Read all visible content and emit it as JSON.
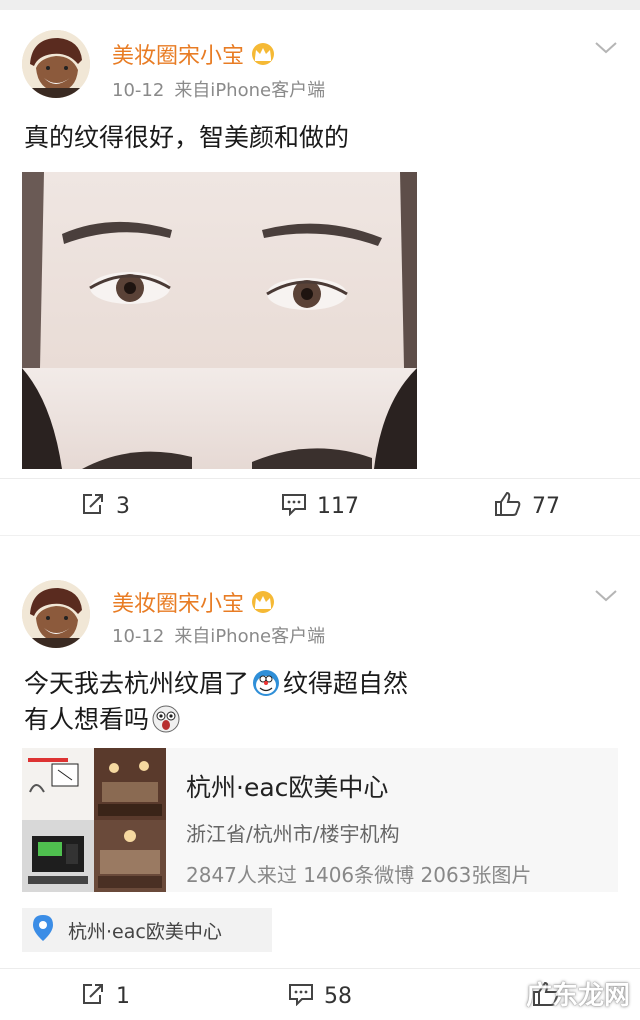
{
  "post1": {
    "username": "美妆圈宋小宝",
    "date": "10-12",
    "source": "来自iPhone客户端",
    "text": "真的纹得很好，智美颜和做的",
    "repost_count": "3",
    "comment_count": "117",
    "like_count": "77"
  },
  "post2": {
    "username": "美妆圈宋小宝",
    "date": "10-12",
    "source": "来自iPhone客户端",
    "text_part1": "今天我去杭州纹眉了",
    "text_part2": "纹得超自然",
    "text_line2": "有人想看吗",
    "card": {
      "title": "杭州·eac欧美中心",
      "subtitle": "浙江省/杭州市/楼宇机构",
      "stats": "2847人来过 1406条微博 2063张图片"
    },
    "location": "杭州·eac欧美中心",
    "repost_count": "1",
    "comment_count": "58"
  },
  "watermark": "广东龙网",
  "colors": {
    "username": "#e87c24",
    "meta": "#8a8a8a",
    "accent_location": "#3b8de6"
  }
}
